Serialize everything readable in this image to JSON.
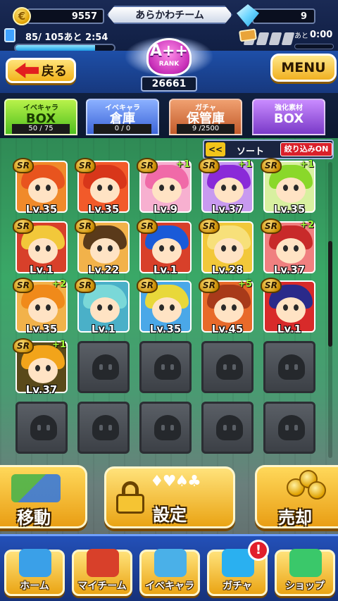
{
  "status": {
    "coins": "9557",
    "team_name": "あらかわチーム",
    "gems": "9",
    "stamina": "85/ 105あと 2:54",
    "stamina_fraction": 0.81,
    "ticket_label": "あと",
    "ticket_time": "0:00"
  },
  "header": {
    "back_label": "戻る",
    "rank_grade": "A++",
    "rank_label": "RANK",
    "rank_value": "26661",
    "menu_label": "MENU"
  },
  "tabs": [
    {
      "small": "イベキャラ",
      "big": "BOX",
      "count": "50 / 75",
      "active": true
    },
    {
      "small": "イベキャラ",
      "big": "倉庫",
      "count": "0 / 0",
      "active": false
    },
    {
      "small": "ガチャ",
      "big": "保管庫",
      "count": "9 /2500",
      "active": false
    },
    {
      "small": "強化素材",
      "big": "BOX",
      "count": "",
      "active": false
    }
  ],
  "sort": {
    "arrows": "<<",
    "label": "ソート",
    "filter_label": "絞り込みON"
  },
  "cards": [
    {
      "rarity": "SR",
      "plus": "",
      "level": "Lv.35",
      "hair": "#e8541e",
      "bg": "#f08a2a"
    },
    {
      "rarity": "SR",
      "plus": "",
      "level": "Lv.35",
      "hair": "#d8361a",
      "bg": "#f25a2a"
    },
    {
      "rarity": "SR",
      "plus": "+1",
      "level": "Lv.9",
      "hair": "#f06aa8",
      "bg": "#f7b0d0"
    },
    {
      "rarity": "SR",
      "plus": "+1",
      "level": "Lv.37",
      "hair": "#8a2ad8",
      "bg": "#c89af0"
    },
    {
      "rarity": "SR",
      "plus": "+1",
      "level": "Lv.35",
      "hair": "#8ad82a",
      "bg": "#d8f0a0"
    },
    {
      "rarity": "SR",
      "plus": "",
      "level": "Lv.1",
      "hair": "#f2c83a",
      "bg": "#d8402a"
    },
    {
      "rarity": "SR",
      "plus": "",
      "level": "Lv.22",
      "hair": "#5a3a1a",
      "bg": "#f2b24a"
    },
    {
      "rarity": "SR",
      "plus": "",
      "level": "Lv.1",
      "hair": "#1a5ad8",
      "bg": "#d8402a"
    },
    {
      "rarity": "SR",
      "plus": "",
      "level": "Lv.28",
      "hair": "#f7e07a",
      "bg": "#f2c83a"
    },
    {
      "rarity": "SR",
      "plus": "+2",
      "level": "Lv.37",
      "hair": "#c82a2a",
      "bg": "#f08080"
    },
    {
      "rarity": "SR",
      "plus": "+2",
      "level": "Lv.35",
      "hair": "#f08a1a",
      "bg": "#f2b24a"
    },
    {
      "rarity": "SR",
      "plus": "",
      "level": "Lv.1",
      "hair": "#7ad8d8",
      "bg": "#4ab0c8"
    },
    {
      "rarity": "SR",
      "plus": "",
      "level": "Lv.35",
      "hair": "#e8d83a",
      "bg": "#4aa8e8"
    },
    {
      "rarity": "SR",
      "plus": "+5",
      "level": "Lv.45",
      "hair": "#a83a1a",
      "bg": "#e86a2a"
    },
    {
      "rarity": "SR",
      "plus": "",
      "level": "Lv.1",
      "hair": "#2a2a8a",
      "bg": "#d82a2a"
    },
    {
      "rarity": "SR",
      "plus": "+1",
      "level": "Lv.37",
      "hair": "#f2a41a",
      "bg": "#5a4a1a"
    }
  ],
  "actions": {
    "move_label": "移動",
    "settings_label": "設定",
    "settings_suits": "♦♥♠♣",
    "sell_label": "売却"
  },
  "nav": [
    {
      "label": "ホーム",
      "icon": "home-icon",
      "color": "#3aa0e8"
    },
    {
      "label": "マイチーム",
      "icon": "team-icon",
      "color": "#d8402a"
    },
    {
      "label": "イベキャラ",
      "icon": "event-character-icon",
      "color": "#4ab0e8"
    },
    {
      "label": "ガチャ",
      "icon": "gacha-icon",
      "color": "#2ab0f0"
    },
    {
      "label": "ショップ",
      "icon": "shop-icon",
      "color": "#3ac86a"
    }
  ],
  "nav_alert": "!"
}
